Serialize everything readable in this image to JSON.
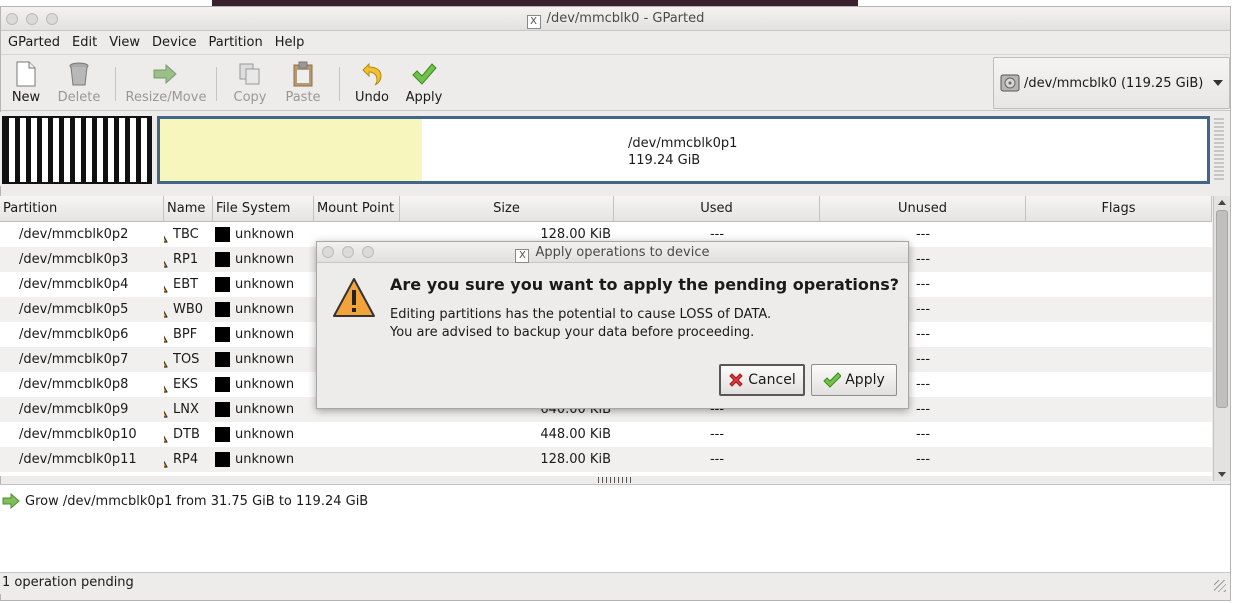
{
  "window": {
    "title": "/dev/mmcblk0 - GParted"
  },
  "menubar": {
    "items": [
      "GParted",
      "Edit",
      "View",
      "Device",
      "Partition",
      "Help"
    ]
  },
  "toolbar": {
    "new_label": "New",
    "delete_label": "Delete",
    "resize_label": "Resize/Move",
    "copy_label": "Copy",
    "paste_label": "Paste",
    "undo_label": "Undo",
    "apply_label": "Apply"
  },
  "device_selector": {
    "value": "/dev/mmcblk0  (119.25 GiB)"
  },
  "disk_map": {
    "partition_name": "/dev/mmcblk0p1",
    "partition_size": "119.24 GiB",
    "used_fraction": 0.25
  },
  "table": {
    "headers": [
      "Partition",
      "Name",
      "File System",
      "Mount Point",
      "Size",
      "Used",
      "Unused",
      "Flags"
    ],
    "rows": [
      {
        "partition": "/dev/mmcblk0p2",
        "name": "TBC",
        "fs": "unknown",
        "mount": "",
        "size": "128.00 KiB",
        "used": "---",
        "unused": "---",
        "flags": ""
      },
      {
        "partition": "/dev/mmcblk0p3",
        "name": "RP1",
        "fs": "unknown",
        "mount": "",
        "size": "",
        "used": "",
        "unused": "---",
        "flags": ""
      },
      {
        "partition": "/dev/mmcblk0p4",
        "name": "EBT",
        "fs": "unknown",
        "mount": "",
        "size": "",
        "used": "",
        "unused": "---",
        "flags": ""
      },
      {
        "partition": "/dev/mmcblk0p5",
        "name": "WB0",
        "fs": "unknown",
        "mount": "",
        "size": "",
        "used": "",
        "unused": "---",
        "flags": ""
      },
      {
        "partition": "/dev/mmcblk0p6",
        "name": "BPF",
        "fs": "unknown",
        "mount": "",
        "size": "",
        "used": "",
        "unused": "---",
        "flags": ""
      },
      {
        "partition": "/dev/mmcblk0p7",
        "name": "TOS",
        "fs": "unknown",
        "mount": "",
        "size": "",
        "used": "",
        "unused": "---",
        "flags": ""
      },
      {
        "partition": "/dev/mmcblk0p8",
        "name": "EKS",
        "fs": "unknown",
        "mount": "",
        "size": "",
        "used": "",
        "unused": "---",
        "flags": ""
      },
      {
        "partition": "/dev/mmcblk0p9",
        "name": "LNX",
        "fs": "unknown",
        "mount": "",
        "size": "640.00 KiB",
        "used": "---",
        "unused": "---",
        "flags": ""
      },
      {
        "partition": "/dev/mmcblk0p10",
        "name": "DTB",
        "fs": "unknown",
        "mount": "",
        "size": "448.00 KiB",
        "used": "---",
        "unused": "---",
        "flags": ""
      },
      {
        "partition": "/dev/mmcblk0p11",
        "name": "RP4",
        "fs": "unknown",
        "mount": "",
        "size": "128.00 KiB",
        "used": "---",
        "unused": "---",
        "flags": ""
      }
    ]
  },
  "log": {
    "operation": "Grow /dev/mmcblk0p1 from 31.75 GiB to 119.24 GiB"
  },
  "status": {
    "text": "1 operation pending"
  },
  "dialog": {
    "title": "Apply operations to device",
    "heading": "Are you sure you want to apply the pending operations?",
    "body_line1": "Editing partitions has the potential to cause LOSS of DATA.",
    "body_line2": "You are advised to backup your data before proceeding.",
    "cancel_label": "Cancel",
    "apply_label": "Apply"
  },
  "colors": {
    "partition_border": "#41668a",
    "used_fill": "#f6f6bd",
    "warning": "#f2a33a"
  }
}
